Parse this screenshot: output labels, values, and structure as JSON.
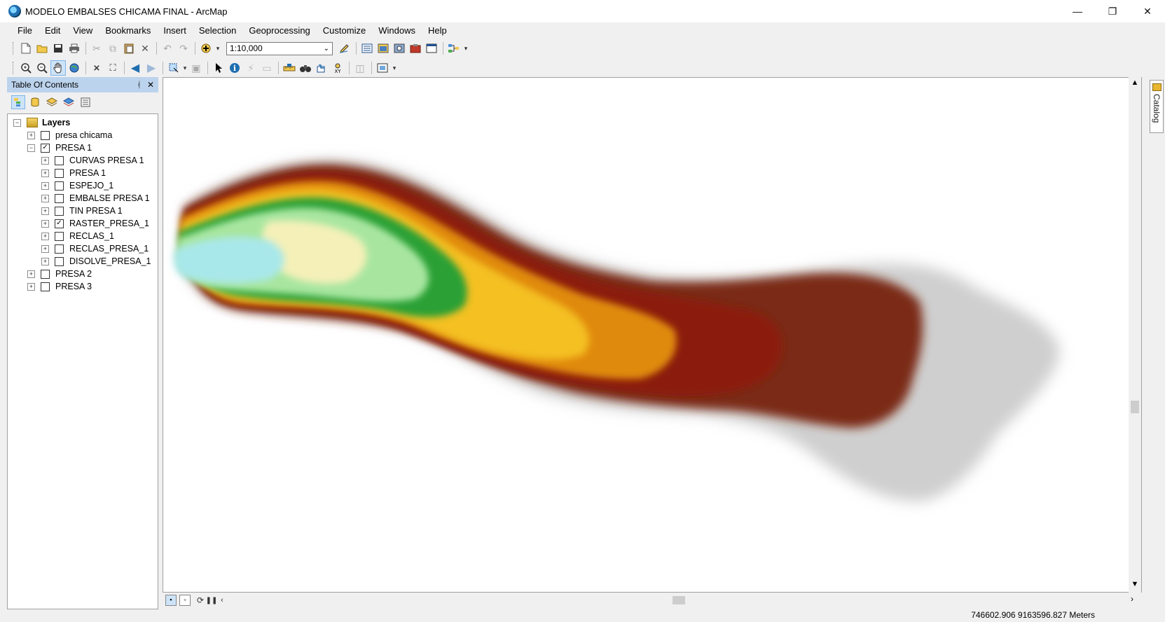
{
  "window": {
    "title": "MODELO EMBALSES CHICAMA FINAL - ArcMap",
    "minimize": "—",
    "maximize": "❐",
    "close": "✕"
  },
  "menu": [
    "File",
    "Edit",
    "View",
    "Bookmarks",
    "Insert",
    "Selection",
    "Geoprocessing",
    "Customize",
    "Windows",
    "Help"
  ],
  "toolbar": {
    "scale": "1:10,000"
  },
  "toc": {
    "title": "Table Of Contents",
    "pin": "ᚮ",
    "close": "✕",
    "root": "Layers",
    "items": [
      {
        "label": "presa chicama",
        "checked": false,
        "expanded": false,
        "level": 1
      },
      {
        "label": "PRESA 1",
        "checked": true,
        "expanded": true,
        "level": 1
      },
      {
        "label": "CURVAS PRESA 1",
        "checked": false,
        "expanded": false,
        "level": 2
      },
      {
        "label": "PRESA 1",
        "checked": false,
        "expanded": false,
        "level": 2
      },
      {
        "label": "ESPEJO_1",
        "checked": false,
        "expanded": false,
        "level": 2
      },
      {
        "label": "EMBALSE PRESA 1",
        "checked": false,
        "expanded": false,
        "level": 2
      },
      {
        "label": "TIN PRESA 1",
        "checked": false,
        "expanded": false,
        "level": 2
      },
      {
        "label": "RASTER_PRESA_1",
        "checked": true,
        "expanded": false,
        "level": 2
      },
      {
        "label": "RECLAS_1",
        "checked": false,
        "expanded": false,
        "level": 2
      },
      {
        "label": "RECLAS_PRESA_1",
        "checked": false,
        "expanded": false,
        "level": 2
      },
      {
        "label": "DISOLVE_PRESA_1",
        "checked": false,
        "expanded": false,
        "level": 2
      },
      {
        "label": "PRESA 2",
        "checked": false,
        "expanded": false,
        "level": 1
      },
      {
        "label": "PRESA 3",
        "checked": false,
        "expanded": false,
        "level": 1
      }
    ]
  },
  "catalog_tab": "Catalog",
  "status": {
    "coordinates": "746602.906  9163596.827 Meters"
  },
  "map_colors": {
    "dark_brown": "#6b1a0a",
    "red_brown": "#8b1c0c",
    "orange": "#e08a10",
    "yellow": "#f4c020",
    "green": "#2aa035",
    "light_green": "#a8e6a0",
    "cyan": "#a9e8ea",
    "cream": "#f4f0b8",
    "gray": "#cfcfcf"
  }
}
